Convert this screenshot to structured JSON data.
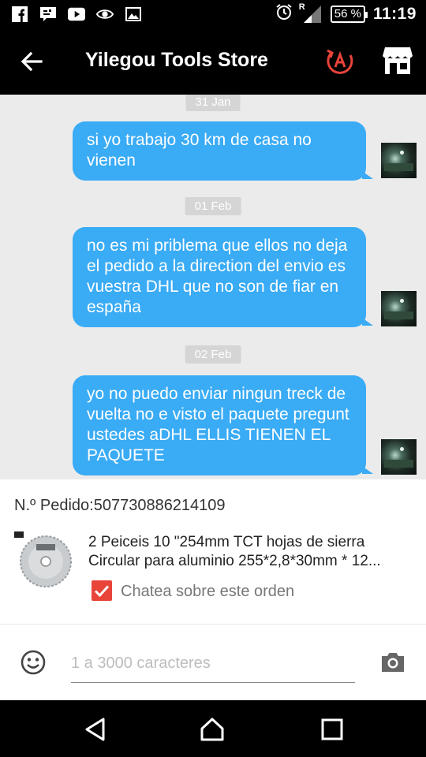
{
  "status_bar": {
    "icons": [
      "facebook-icon",
      "messenger-icon",
      "youtube-icon",
      "eye-icon",
      "image-icon"
    ],
    "roaming": "R",
    "battery": "56 %",
    "time": "11:19"
  },
  "app_bar": {
    "title": "Yilegou Tools Store",
    "back_icon": "arrow-left-icon",
    "action_icons": [
      "translate-icon",
      "store-icon"
    ],
    "accent": "#e8443a"
  },
  "chat": {
    "bubble_color": "#3aabf5",
    "messages": [
      {
        "date": "31 Jan",
        "text": "si yo trabajo 30 km de casa no vienen"
      },
      {
        "date": "01 Feb",
        "text": "no es mi priblema que ellos no deja el pedido a la direction del envio es vuestra DHL que no son de fiar en españa"
      },
      {
        "date": "02 Feb",
        "text": "yo no puedo enviar ningun treck de vuelta no e visto el paquete pregunt ustedes aDHL ELLIS TIENEN EL PAQUETE"
      }
    ]
  },
  "order": {
    "label": "N.º Pedido:",
    "number": "507730886214109",
    "product_line1": "2 Peiceis 10 \"254mm TCT hojas de sierra",
    "product_line2": "Circular para aluminio 255*2,8*30mm * 12...",
    "checkbox_label": "Chatea sobre este orden",
    "checked": true
  },
  "composer": {
    "placeholder": "1 a 3000 caracteres",
    "emoji_icon": "smiley-icon",
    "camera_icon": "camera-icon"
  },
  "nav_bar": {
    "icons": [
      "back-triangle-icon",
      "home-icon",
      "recents-icon"
    ]
  }
}
